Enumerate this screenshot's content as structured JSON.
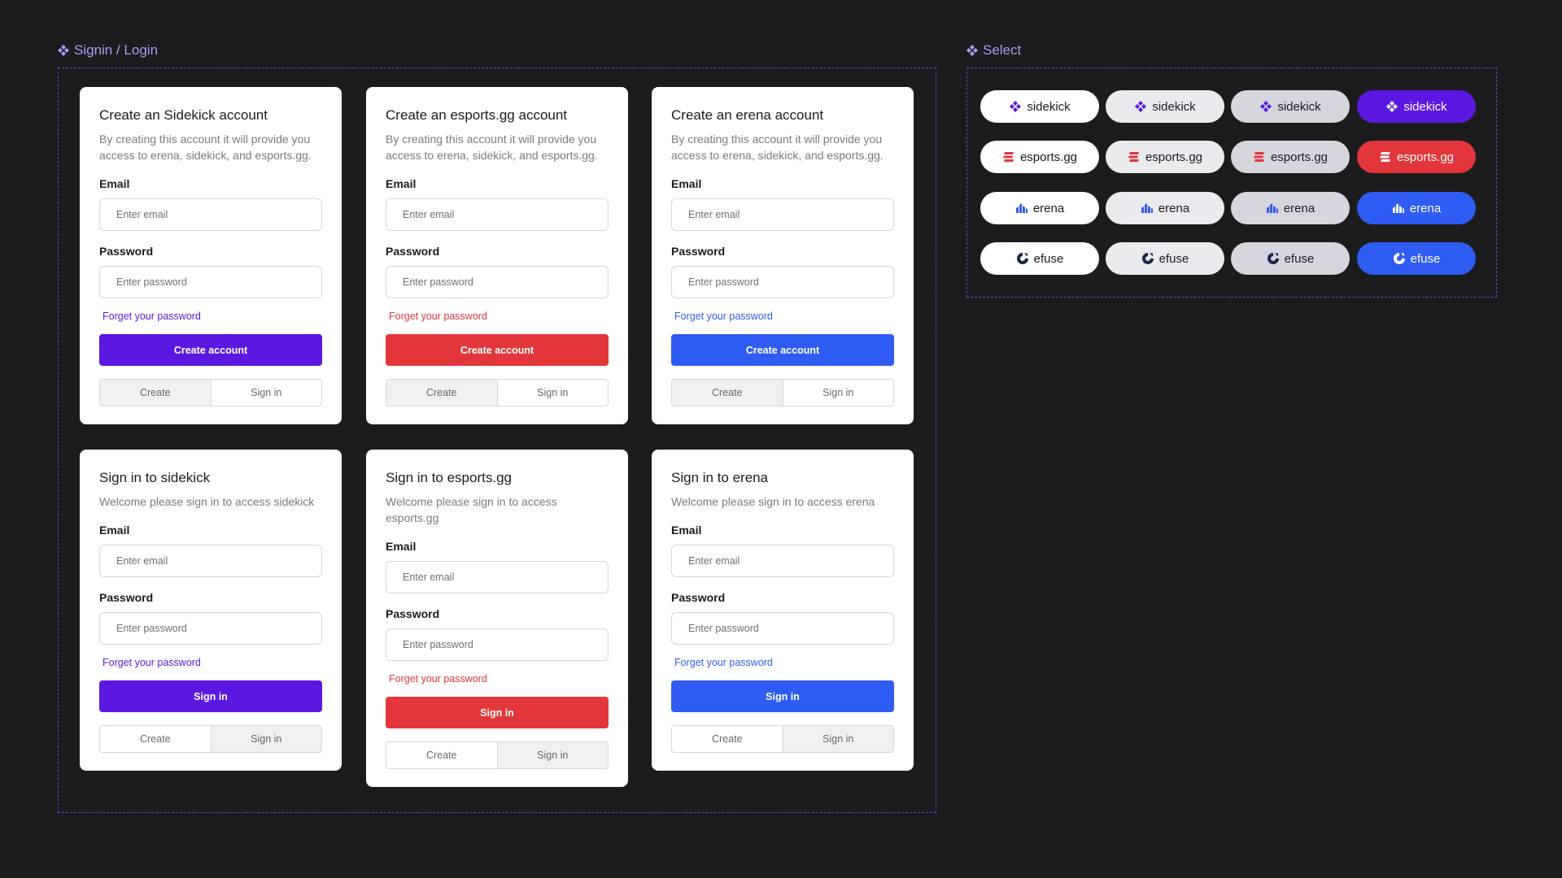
{
  "sections": {
    "login_title": "Signin / Login",
    "select_title": "Select"
  },
  "colors": {
    "sidekick": "#5b18e0",
    "esports": "#e2363b",
    "erena": "#2f5cf2",
    "accent_title": "#a99cf2"
  },
  "common": {
    "email_label": "Email",
    "password_label": "Password",
    "email_placeholder": "Enter email",
    "password_placeholder": "Enter password",
    "forgot": "Forget your password",
    "seg_create": "Create",
    "seg_signin": "Sign in"
  },
  "create_cards": [
    {
      "title": "Create an Sidekick account",
      "desc": "By creating this account it will provide you access to erena, sidekick, and esports.gg.",
      "button": "Create account"
    },
    {
      "title": "Create an esports.gg account",
      "desc": "By creating this account it will provide you access to erena, sidekick, and esports.gg.",
      "button": "Create account"
    },
    {
      "title": "Create an erena account",
      "desc": "By creating this account it will provide you access to erena, sidekick, and esports.gg.",
      "button": "Create account"
    }
  ],
  "signin_cards": [
    {
      "title": "Sign in to sidekick",
      "desc": "Welcome please sign in to access sidekick",
      "button": "Sign in"
    },
    {
      "title": "Sign in to esports.gg",
      "desc": "Welcome please sign in to access esports.gg",
      "button": "Sign in"
    },
    {
      "title": "Sign in to erena",
      "desc": "Welcome please sign in to access erena",
      "button": "Sign in"
    }
  ],
  "select": {
    "sidekick": "sidekick",
    "esports": "esports.gg",
    "erena": "erena",
    "efuse": "efuse",
    "icons": [
      "sidekick-logo-icon",
      "esports-logo-icon",
      "erena-logo-icon",
      "efuse-logo-icon"
    ]
  }
}
